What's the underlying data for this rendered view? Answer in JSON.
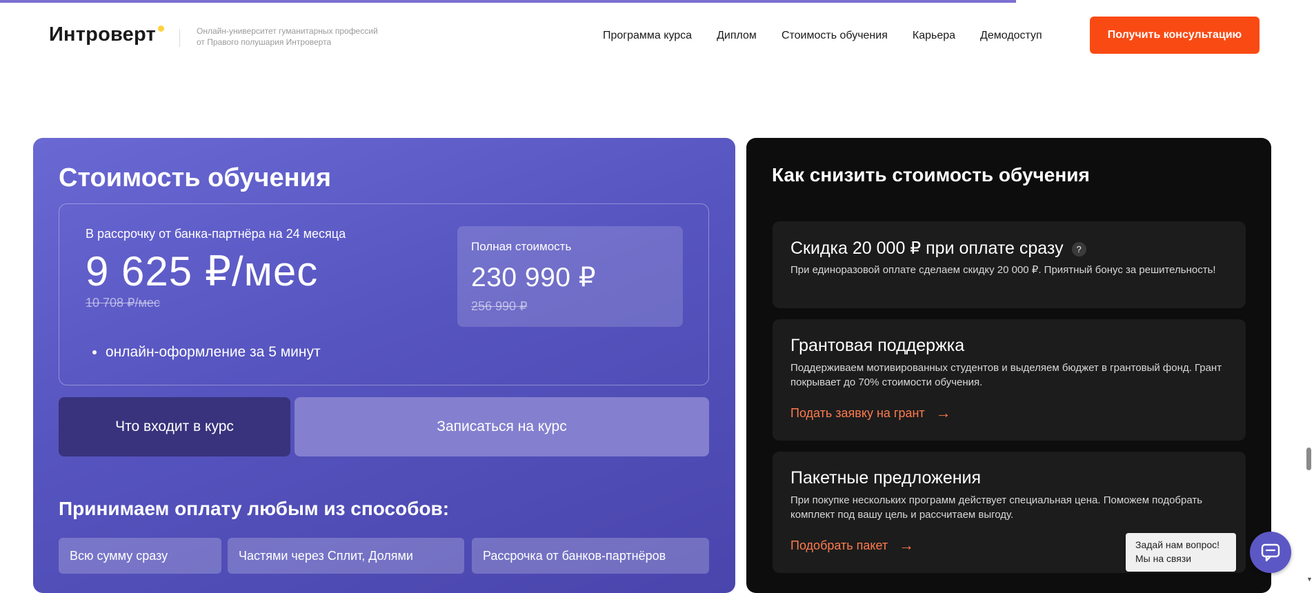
{
  "header": {
    "logo": "Интроверт",
    "tagline_line1": "Онлайн-университет гуманитарных профессий",
    "tagline_line2": "от Правого полушария Интроверта",
    "nav": [
      "Программа курса",
      "Диплом",
      "Стоимость обучения",
      "Карьера",
      "Демодоступ"
    ],
    "cta": "Получить консультацию"
  },
  "pricing": {
    "title": "Стоимость обучения",
    "installment_label": "В рассрочку от банка-партнёра на 24 месяца",
    "installment_price": "9 625 ₽/мес",
    "installment_old": "10 708 ₽/мес",
    "bullet": "онлайн-оформление за 5 минут",
    "full_label": "Полная стоимость",
    "full_price": "230 990 ₽",
    "full_old": "256 990 ₽",
    "btn_course": "Что входит в курс",
    "btn_enroll": "Записаться на курс",
    "payment_title": "Принимаем оплату любым из способов:",
    "payment_methods": [
      "Всю сумму сразу",
      "Частями через Сплит, Долями",
      "Рассрочка от банков-партнёров"
    ]
  },
  "discounts": {
    "title": "Как снизить стоимость обучения",
    "offers": [
      {
        "title": "Скидка 20 000 ₽ при оплате сразу",
        "badge": "?",
        "desc": "При единоразовой оплате сделаем скидку 20 000 ₽. Приятный бонус за решительность!"
      },
      {
        "title": "Грантовая поддержка",
        "desc": "Поддерживаем мотивированных студентов и выделяем бюджет в грантовый фонд. Грант покрывает до 70% стоимости обучения.",
        "link": "Подать заявку на грант"
      },
      {
        "title": "Пакетные предложения",
        "desc": "При покупке нескольких программ действует специальная цена. Поможем подобрать комплект под вашу цель и рассчитаем выгоду.",
        "link": "Подобрать пакет"
      }
    ]
  },
  "chat": {
    "line1": "Задай нам вопрос!",
    "line2": "Мы на связи"
  },
  "colors": {
    "accent": "#fa4a14",
    "brand_purple": "#5b57c4",
    "link_orange": "#ff7a4d"
  },
  "icons": [
    "arrow-right-icon",
    "chat-icon",
    "question-icon"
  ]
}
